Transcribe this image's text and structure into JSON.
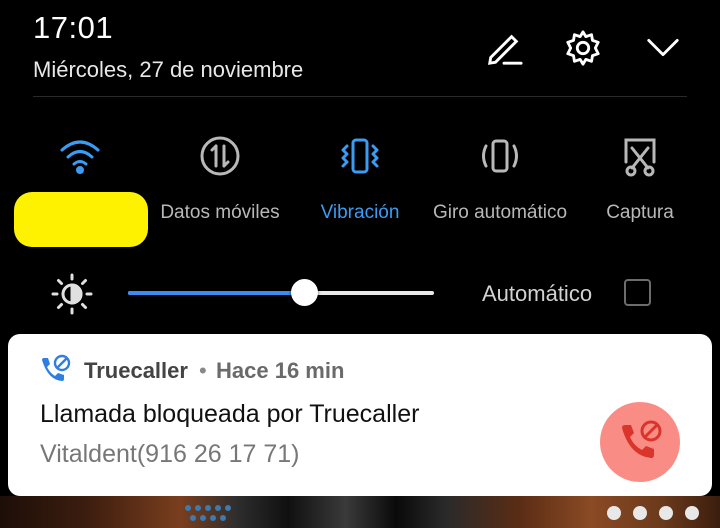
{
  "status": {
    "time": "17:01",
    "date": "Miércoles, 27 de noviembre"
  },
  "header_icons": [
    "edit-icon",
    "gear-icon",
    "chevron-down-icon"
  ],
  "tiles": [
    {
      "label": "",
      "icon": "wifi-icon",
      "active": true
    },
    {
      "label": "Datos móviles",
      "icon": "mobile-data-icon",
      "active": false
    },
    {
      "label": "Vibración",
      "icon": "vibration-icon",
      "active": true
    },
    {
      "label": "Giro automático",
      "icon": "auto-rotate-icon",
      "active": false
    },
    {
      "label": "Captura",
      "icon": "screenshot-icon",
      "active": false
    }
  ],
  "brightness": {
    "level": 0.58,
    "auto_label": "Automático",
    "auto_checked": false
  },
  "notification": {
    "app_name": "Truecaller",
    "separator": "•",
    "time_ago": "Hace 16 min",
    "title": "Llamada bloqueada por Truecaller",
    "text": "Vitaldent(916 26 17 71)",
    "accent_color": "#f98d86",
    "icon_color": "#2f7fe0"
  },
  "colors": {
    "active": "#3a9cf2",
    "inactive": "#b8b8b8",
    "redaction": "#fff200"
  }
}
